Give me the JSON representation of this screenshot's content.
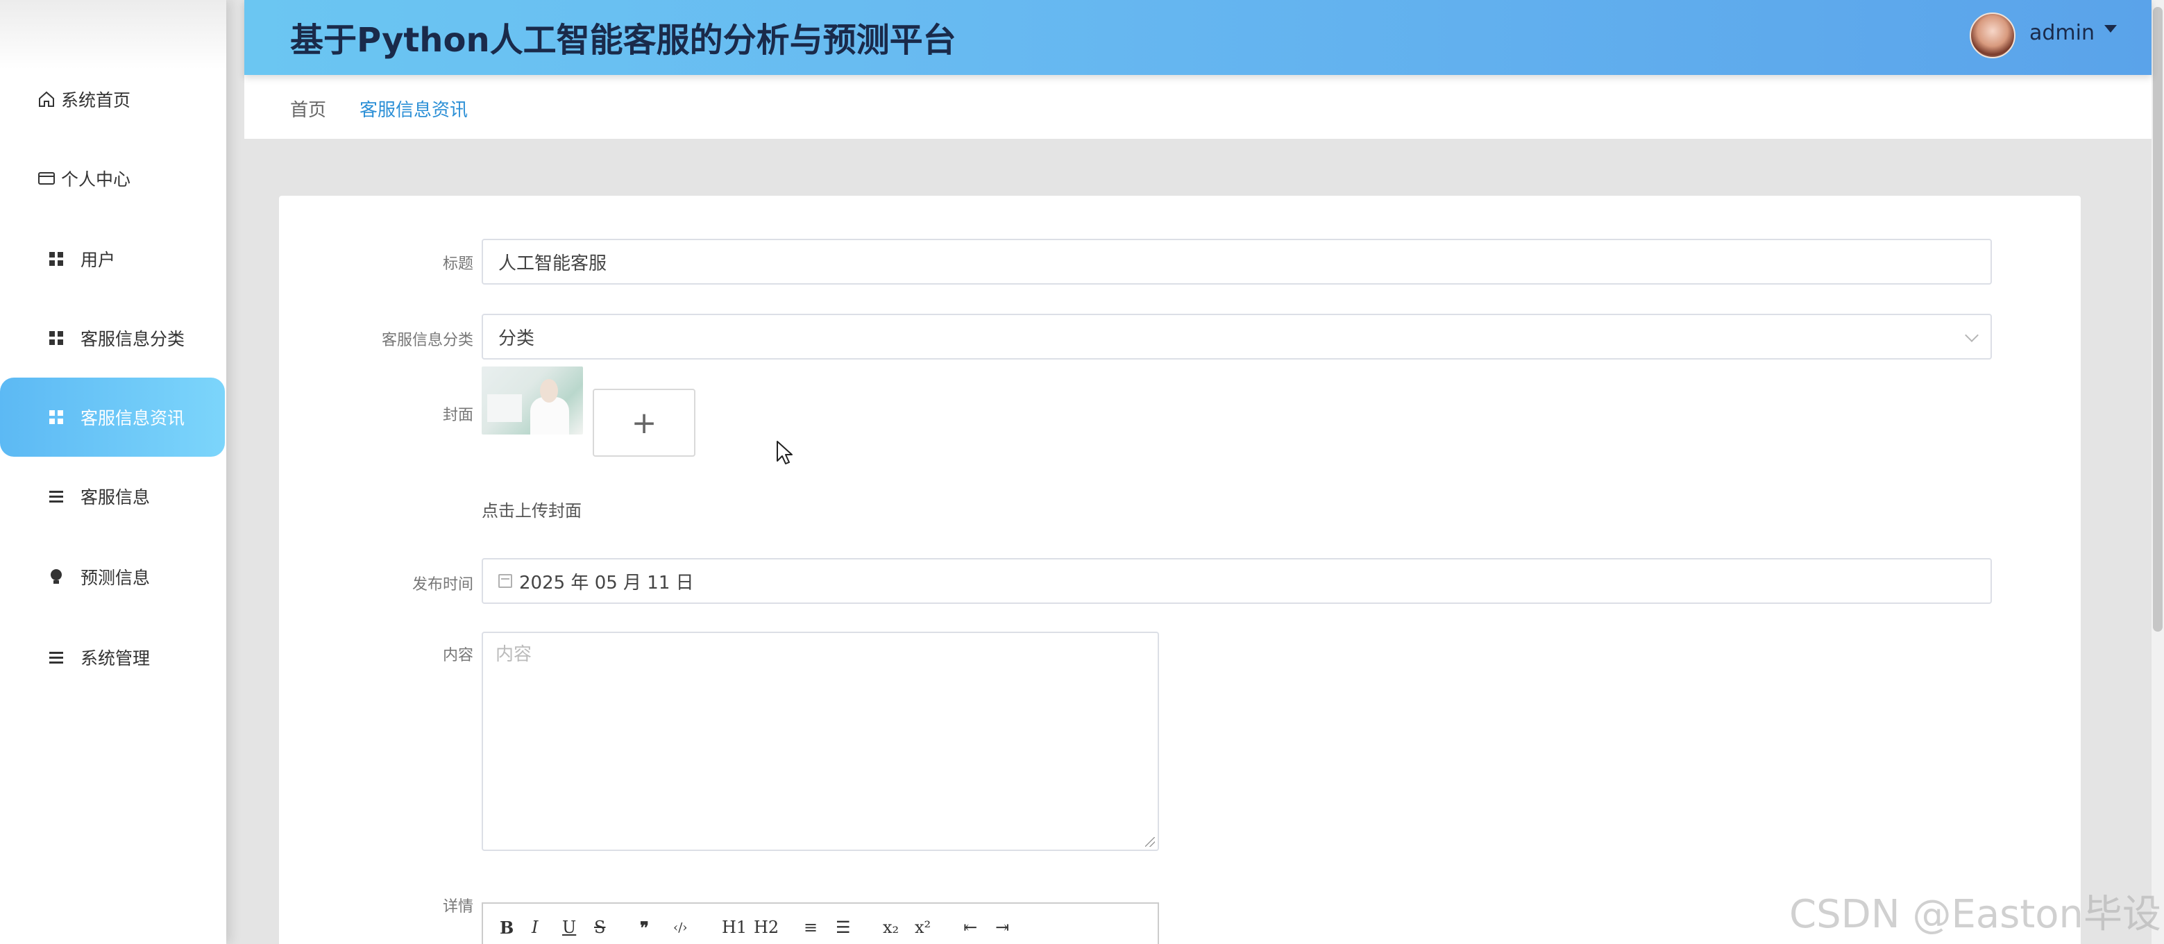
{
  "header": {
    "title": "基于Python人工智能客服的分析与预测平台",
    "username": "admin"
  },
  "sidebar": {
    "items": [
      {
        "label": "系统首页",
        "icon": "home-icon"
      },
      {
        "label": "个人中心",
        "icon": "card-icon"
      },
      {
        "label": "用户",
        "icon": "grid-icon"
      },
      {
        "label": "客服信息分类",
        "icon": "grid-icon"
      },
      {
        "label": "客服信息资讯",
        "icon": "grid-icon",
        "active": true
      },
      {
        "label": "客服信息",
        "icon": "list-icon"
      },
      {
        "label": "预测信息",
        "icon": "bulb-icon"
      },
      {
        "label": "系统管理",
        "icon": "list-icon"
      }
    ]
  },
  "breadcrumb": {
    "home": "首页",
    "current": "客服信息资讯"
  },
  "form": {
    "title_label": "标题",
    "title_value": "人工智能客服",
    "category_label": "客服信息分类",
    "category_value": "分类",
    "cover_label": "封面",
    "upload_plus": "+",
    "upload_hint": "点击上传封面",
    "date_label": "发布时间",
    "date_value": "2025 年 05 月 11 日",
    "content_label": "内容",
    "content_placeholder": "内容",
    "detail_label": "详情"
  },
  "editor_toolbar": [
    "B",
    "I",
    "U",
    "S",
    "❞",
    "‹/›",
    "H1",
    "H2",
    "≡",
    "☰",
    "x₂",
    "x²",
    "⇤",
    "⇥"
  ],
  "watermark": "CSDN @Easton毕设",
  "colors": {
    "header_gradient_start": "#6bc6f2",
    "header_gradient_end": "#5aa3ea",
    "active_menu": "#5cb9f4",
    "link": "#2b8fd6"
  }
}
